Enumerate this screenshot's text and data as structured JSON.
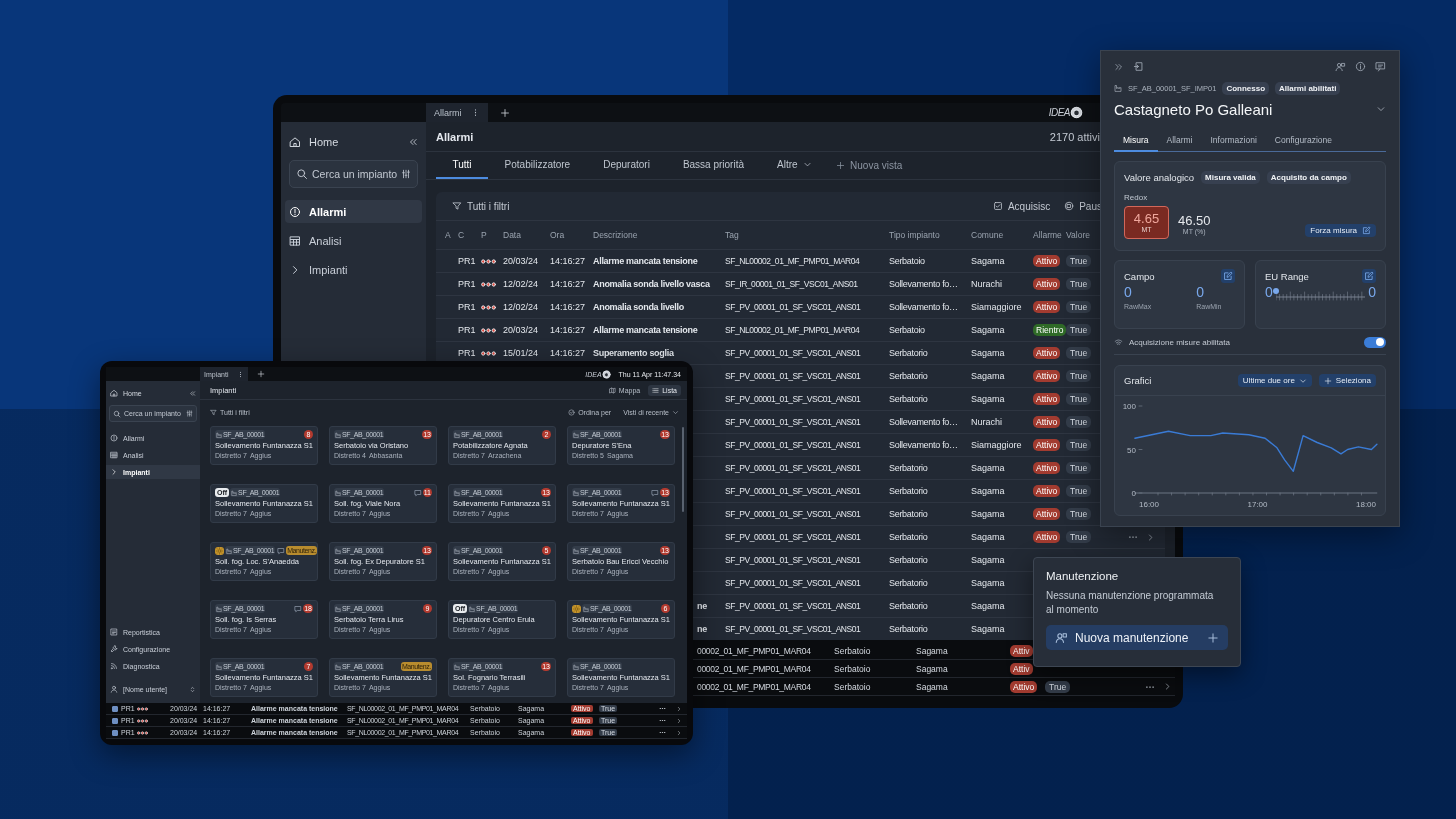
{
  "alarms_screen": {
    "tab": {
      "label": "Allarmi",
      "selected": true
    },
    "logo": "IDEA",
    "sidebar": {
      "home": "Home",
      "search_placeholder": "Cerca un impianto",
      "items": [
        {
          "label": "Allarmi",
          "selected": true
        },
        {
          "label": "Analisi",
          "selected": false
        },
        {
          "label": "Impianti",
          "selected": false
        }
      ]
    },
    "title": "Allarmi",
    "count": "2170 attivi",
    "views": [
      {
        "label": "Tutti",
        "selected": true
      },
      {
        "label": "Potabilizzatore",
        "selected": false
      },
      {
        "label": "Depuratori",
        "selected": false
      },
      {
        "label": "Bassa priorità",
        "selected": false
      },
      {
        "label": "Altre",
        "selected": false,
        "dropdown": true
      }
    ],
    "new_view": "Nuova vista",
    "filters": "Tutti i filtri",
    "actions": [
      "Acquisisc",
      "Paus"
    ],
    "columns": [
      "A",
      "C",
      "P",
      "Data",
      "Ora",
      "Descrizione",
      "Tag",
      "Tipo impianto",
      "Comune",
      "Allarme",
      "Valore"
    ],
    "rows": [
      {
        "priority": "PR1",
        "date": "20/03/24",
        "time": "14:16:27",
        "description": "Allarme mancata tensione",
        "tag": "SF_NL00002_01_MF_PMP01_MAR04",
        "type": "Serbatoio",
        "town": "Sagama",
        "alarm": {
          "label": "Attivo",
          "color": "#a23b30"
        },
        "value": "True"
      },
      {
        "priority": "PR1",
        "date": "12/02/24",
        "time": "14:16:27",
        "description": "Anomalia sonda livello vasca",
        "tag": "SF_IR_00001_01_SF_VSC01_ANS01",
        "type": "Sollevamento fo…",
        "town": "Nurachi",
        "alarm": {
          "label": "Attivo",
          "color": "#a23b30"
        },
        "value": "True"
      },
      {
        "priority": "PR1",
        "date": "12/02/24",
        "time": "14:16:27",
        "description": "Anomalia sonda livello",
        "tag": "SF_PV_00001_01_SF_VSC01_ANS01",
        "type": "Sollevamento fo…",
        "town": "Siamaggiore",
        "alarm": {
          "label": "Attivo",
          "color": "#a23b30"
        },
        "value": "True"
      },
      {
        "priority": "PR1",
        "date": "20/03/24",
        "time": "14:16:27",
        "description": "Allarme mancata tensione",
        "tag": "SF_NL00002_01_MF_PMP01_MAR04",
        "type": "Serbatoio",
        "town": "Sagama",
        "alarm": {
          "label": "Rientro",
          "color": "#2f6a27"
        },
        "value": "True"
      },
      {
        "priority": "PR1",
        "date": "15/01/24",
        "time": "14:16:27",
        "description": "Superamento soglia",
        "tag": "SF_PV_00001_01_SF_VSC01_ANS01",
        "type": "Serbatorio",
        "town": "Sagama",
        "alarm": {
          "label": "Attivo",
          "color": "#a23b30"
        },
        "value": "True"
      },
      {
        "tag": "SF_PV_00001_01_SF_VSC01_ANS01",
        "type": "Serbatorio",
        "town": "Sagama",
        "alarm": {
          "label": "Attivo",
          "color": "#a23b30"
        },
        "value": "True"
      },
      {
        "tag": "SF_PV_00001_01_SF_VSC01_ANS01",
        "type": "Serbatorio",
        "town": "Sagama",
        "alarm": {
          "label": "Attivo",
          "color": "#a23b30"
        },
        "value": "True"
      },
      {
        "tag": "SF_PV_00001_01_SF_VSC01_ANS01",
        "type": "Sollevamento fo…",
        "town": "Nurachi",
        "alarm": {
          "label": "Attivo",
          "color": "#a23b30"
        },
        "value": "True"
      },
      {
        "tag": "SF_PV_00001_01_SF_VSC01_ANS01",
        "type": "Sollevamento fo…",
        "town": "Siamaggiore",
        "alarm": {
          "label": "Attivo",
          "color": "#a23b30"
        },
        "value": "True"
      },
      {
        "tag": "SF_PV_00001_01_SF_VSC01_ANS01",
        "type": "Serbatorio",
        "town": "Sagama",
        "alarm": {
          "label": "Attivo",
          "color": "#a23b30"
        },
        "value": "True"
      },
      {
        "tag": "SF_PV_00001_01_SF_VSC01_ANS01",
        "type": "Serbatorio",
        "town": "Sagama",
        "alarm": {
          "label": "Attivo",
          "color": "#a23b30"
        },
        "value": "True"
      },
      {
        "tag": "SF_PV_00001_01_SF_VSC01_ANS01",
        "type": "Serbatorio",
        "town": "Sagama",
        "alarm": {
          "label": "Attivo",
          "color": "#a23b30"
        },
        "value": "True"
      },
      {
        "tag": "SF_PV_00001_01_SF_VSC01_ANS01",
        "type": "Serbatorio",
        "town": "Sagama",
        "alarm": {
          "label": "Attivo",
          "color": "#a23b30"
        },
        "value": "True",
        "actions": true
      },
      {
        "tag": "SF_PV_00001_01_SF_VSC01_ANS01",
        "type": "Serbatorio",
        "town": "Sagama"
      },
      {
        "tag": "SF_PV_00001_01_SF_VSC01_ANS01",
        "type": "Serbatorio",
        "town": "Sagama"
      },
      {
        "description": "ne",
        "tag": "SF_PV_00001_01_SF_VSC01_ANS01",
        "type": "Serbatorio",
        "town": "Sagama"
      },
      {
        "description": "ne",
        "tag": "SF_PV_00001_01_SF_VSC01_ANS01",
        "type": "Serbatorio",
        "town": "Sagama"
      }
    ],
    "dock_rows": [
      {
        "tag": "00002_01_MF_PMP01_MAR04",
        "type": "Serbatoio",
        "town": "Sagama",
        "alarm": {
          "label": "Attiv",
          "color": "#a23b30"
        }
      },
      {
        "tag": "00002_01_MF_PMP01_MAR04",
        "type": "Serbatoio",
        "town": "Sagama",
        "alarm": {
          "label": "Attiv",
          "color": "#a23b30"
        }
      },
      {
        "tag": "00002_01_MF_PMP01_MAR04",
        "type": "Serbatoio",
        "town": "Sagama",
        "alarm": {
          "label": "Attivo",
          "color": "#a23b30"
        },
        "value": "True",
        "actions": true
      }
    ]
  },
  "plants_screen": {
    "tab": {
      "label": "Impianti",
      "selected": true
    },
    "logo": "IDEA",
    "clock": "Thu 11 Apr 11:47.34",
    "sidebar": {
      "home": "Home",
      "search_placeholder": "Cerca un impianto",
      "items": [
        {
          "label": "Allarmi",
          "selected": false
        },
        {
          "label": "Analisi",
          "selected": false
        },
        {
          "label": "Impianti",
          "selected": true
        }
      ],
      "bottom_items": [
        "Reportistica",
        "Configurazione",
        "Diagnostica"
      ],
      "user": "[Nome utente]"
    },
    "title": "Impianti",
    "view_modes": [
      {
        "label": "Mappa",
        "selected": false
      },
      {
        "label": "Lista",
        "selected": true
      }
    ],
    "filters": "Tutti i filtri",
    "sort_label": "Ordina per",
    "sort_value": "Visti di recente",
    "cards": [
      {
        "tag": "SF_AB_00001",
        "name": "Sollevamento Funtanazza S1",
        "district": "Distretto 7",
        "town": "Aggius",
        "alarms": "8"
      },
      {
        "tag": "SF_AB_00001",
        "name": "Serbatoio via Oristano",
        "district": "Distretto 4",
        "town": "Abbasanta",
        "alarms": "13"
      },
      {
        "tag": "SF_AB_00001",
        "name": "Potabilizzatore Agnata",
        "district": "Distretto 7",
        "town": "Arzachena",
        "alarms": "2"
      },
      {
        "tag": "SF_AB_00001",
        "name": "Depuratore S'Ena",
        "district": "Distretto 5",
        "town": "Sagama",
        "alarms": "13"
      },
      {
        "status_badge": "Off",
        "tag": "SF_AB_00001",
        "name": "Sollevamento Funtanazza S1",
        "district": "Distretto 7",
        "town": "Aggius"
      },
      {
        "tag": "SF_AB_00001",
        "name": "Soll. fog. Viale Nora",
        "district": "Distretto 7",
        "town": "Aggius",
        "comment": true,
        "alarms": "11"
      },
      {
        "tag": "SF_AB_00001",
        "name": "Sollevamento Funtanazza S1",
        "district": "Distretto 7",
        "town": "Aggius",
        "alarms": "13"
      },
      {
        "tag": "SF_AB_00001",
        "name": "Sollevamento Funtanazza S1",
        "district": "Distretto 7",
        "town": "Aggius",
        "comment": true,
        "alarms": "13"
      },
      {
        "maintenance": true,
        "tag": "SF_AB_00001",
        "name": "Soll. fog. Loc. S'Anaedda",
        "district": "Distretto 7",
        "town": "Aggius",
        "comment": true,
        "note": "Manutenz."
      },
      {
        "tag": "SF_AB_00001",
        "name": "Soll. fog. Ex Depuratore S1",
        "district": "Distretto 7",
        "town": "Aggius",
        "alarms": "13"
      },
      {
        "tag": "SF_AB_00001",
        "name": "Sollevamento Funtanazza S1",
        "district": "Distretto 7",
        "town": "Aggius",
        "alarms": "5"
      },
      {
        "tag": "SF_AB_00001",
        "name": "Serbatoio Bau Ericci Vecchio",
        "district": "Distretto 7",
        "town": "Aggius",
        "alarms": "13"
      },
      {
        "tag": "SF_AB_00001",
        "name": "Soll. fog. Is Serras",
        "district": "Distretto 7",
        "town": "Aggius",
        "comment": true,
        "alarms": "18"
      },
      {
        "tag": "SF_AB_00001",
        "name": "Serbatoio Terra Lirus",
        "district": "Distretto 7",
        "town": "Aggius",
        "alarms": "9"
      },
      {
        "status_badge": "Off",
        "tag": "SF_AB_00001",
        "name": "Depuratore Centro Erula",
        "district": "Distretto 7",
        "town": "Aggius"
      },
      {
        "maintenance": true,
        "tag": "SF_AB_00001",
        "name": "Sollevamento Funtanazza S1",
        "district": "Distretto 7",
        "town": "Aggius",
        "alarms": "6"
      },
      {
        "tag": "SF_AB_00001",
        "name": "Sollevamento Funtanazza S1",
        "district": "Distretto 7",
        "town": "Aggius",
        "alarms": "7"
      },
      {
        "tag": "SF_AB_00001",
        "name": "Sollevamento Funtanazza S1",
        "district": "Distretto 7",
        "town": "Aggius",
        "note": "Manutenz."
      },
      {
        "tag": "SF_AB_00001",
        "name": "Sol. Fognario Terrasili",
        "district": "Distretto 7",
        "town": "Aggius",
        "alarms": "13"
      },
      {
        "tag": "SF_AB_00001",
        "name": "Sollevamento Funtanazza S1",
        "district": "Distretto 7",
        "town": "Aggius"
      }
    ],
    "dock_rows": [
      {
        "checked": true,
        "priority": "PR1",
        "date": "20/03/24",
        "time": "14:16:27",
        "description": "Allarme mancata tensione",
        "tag": "SF_NL00002_01_MF_PMP01_MAR04",
        "type": "Serbatoio",
        "town": "Sagama",
        "alarm": {
          "label": "Attivo",
          "color": "#a23b30"
        },
        "value": "True"
      },
      {
        "checked": true,
        "priority": "PR1",
        "date": "20/03/24",
        "time": "14:16:27",
        "description": "Allarme mancata tensione",
        "tag": "SF_NL00002_01_MF_PMP01_MAR04",
        "type": "Serbatoio",
        "town": "Sagama",
        "alarm": {
          "label": "Attivo",
          "color": "#a23b30"
        },
        "value": "True"
      },
      {
        "checked": true,
        "priority": "PR1",
        "date": "20/03/24",
        "time": "14:16:27",
        "description": "Allarme mancata tensione",
        "tag": "SF_NL00002_01_MF_PMP01_MAR04",
        "type": "Serbatoio",
        "town": "Sagama",
        "alarm": {
          "label": "Attivo",
          "color": "#a23b30"
        },
        "value": "True"
      }
    ]
  },
  "detail_panel": {
    "tag": "SF_AB_00001_SF_IMP01",
    "badges": [
      "Connesso",
      "Allarmi abilitati"
    ],
    "title": "Castagneto Po Galleani",
    "tabs": [
      {
        "label": "Misura",
        "selected": true
      },
      {
        "label": "Allarmi",
        "selected": false
      },
      {
        "label": "Informazioni",
        "selected": false
      },
      {
        "label": "Configurazione",
        "selected": false
      }
    ],
    "analog": {
      "title": "Valore analogico",
      "badges": [
        "Misura valida",
        "Acquisito da campo"
      ],
      "label": "Redox",
      "value": "4.65",
      "unit": "MT",
      "percent": "46.50",
      "percent_unit": "MT (%)",
      "button": "Forza misura"
    },
    "field": {
      "title": "Campo",
      "items": [
        {
          "value": "0",
          "label": "RawMax"
        },
        {
          "value": "0",
          "label": "RawMin"
        }
      ]
    },
    "eu_range": {
      "title": "EU Range",
      "min": "0",
      "max": "0",
      "level": 0
    },
    "acquisition": {
      "label": "Acquisizione misure abilitata",
      "on": true
    },
    "charts": {
      "title": "Grafici",
      "range": "Ultime due ore",
      "select": "Seleziona",
      "chart_data": {
        "type": "line",
        "x": [
          15.87,
          16.18,
          16.38,
          16.57,
          16.68,
          16.92,
          17.07,
          17.18,
          17.25,
          17.33,
          17.42,
          17.55,
          17.68,
          17.77,
          17.83,
          17.93,
          18.05,
          18.1
        ],
        "series": [
          {
            "color": "#3a7bd5",
            "values": [
              63,
              71,
              66,
              66,
              69,
              67,
              63,
              52,
              38,
              25,
              66,
              58,
              52,
              45,
              50,
              53,
              50,
              56
            ]
          }
        ],
        "xlim": [
          15.87,
          18.1
        ],
        "ylim": [
          0,
          100
        ],
        "yticks": [
          0,
          50,
          100
        ],
        "xticks": [
          {
            "value": 16,
            "label": "16:00"
          },
          {
            "value": 17,
            "label": "17:00"
          },
          {
            "value": 18,
            "label": "18:00"
          }
        ]
      }
    }
  },
  "maintenance_popup": {
    "title": "Manutenzione",
    "message": "Nessuna manutenzione programmata al momento",
    "button": "Nuova manutenzione"
  }
}
